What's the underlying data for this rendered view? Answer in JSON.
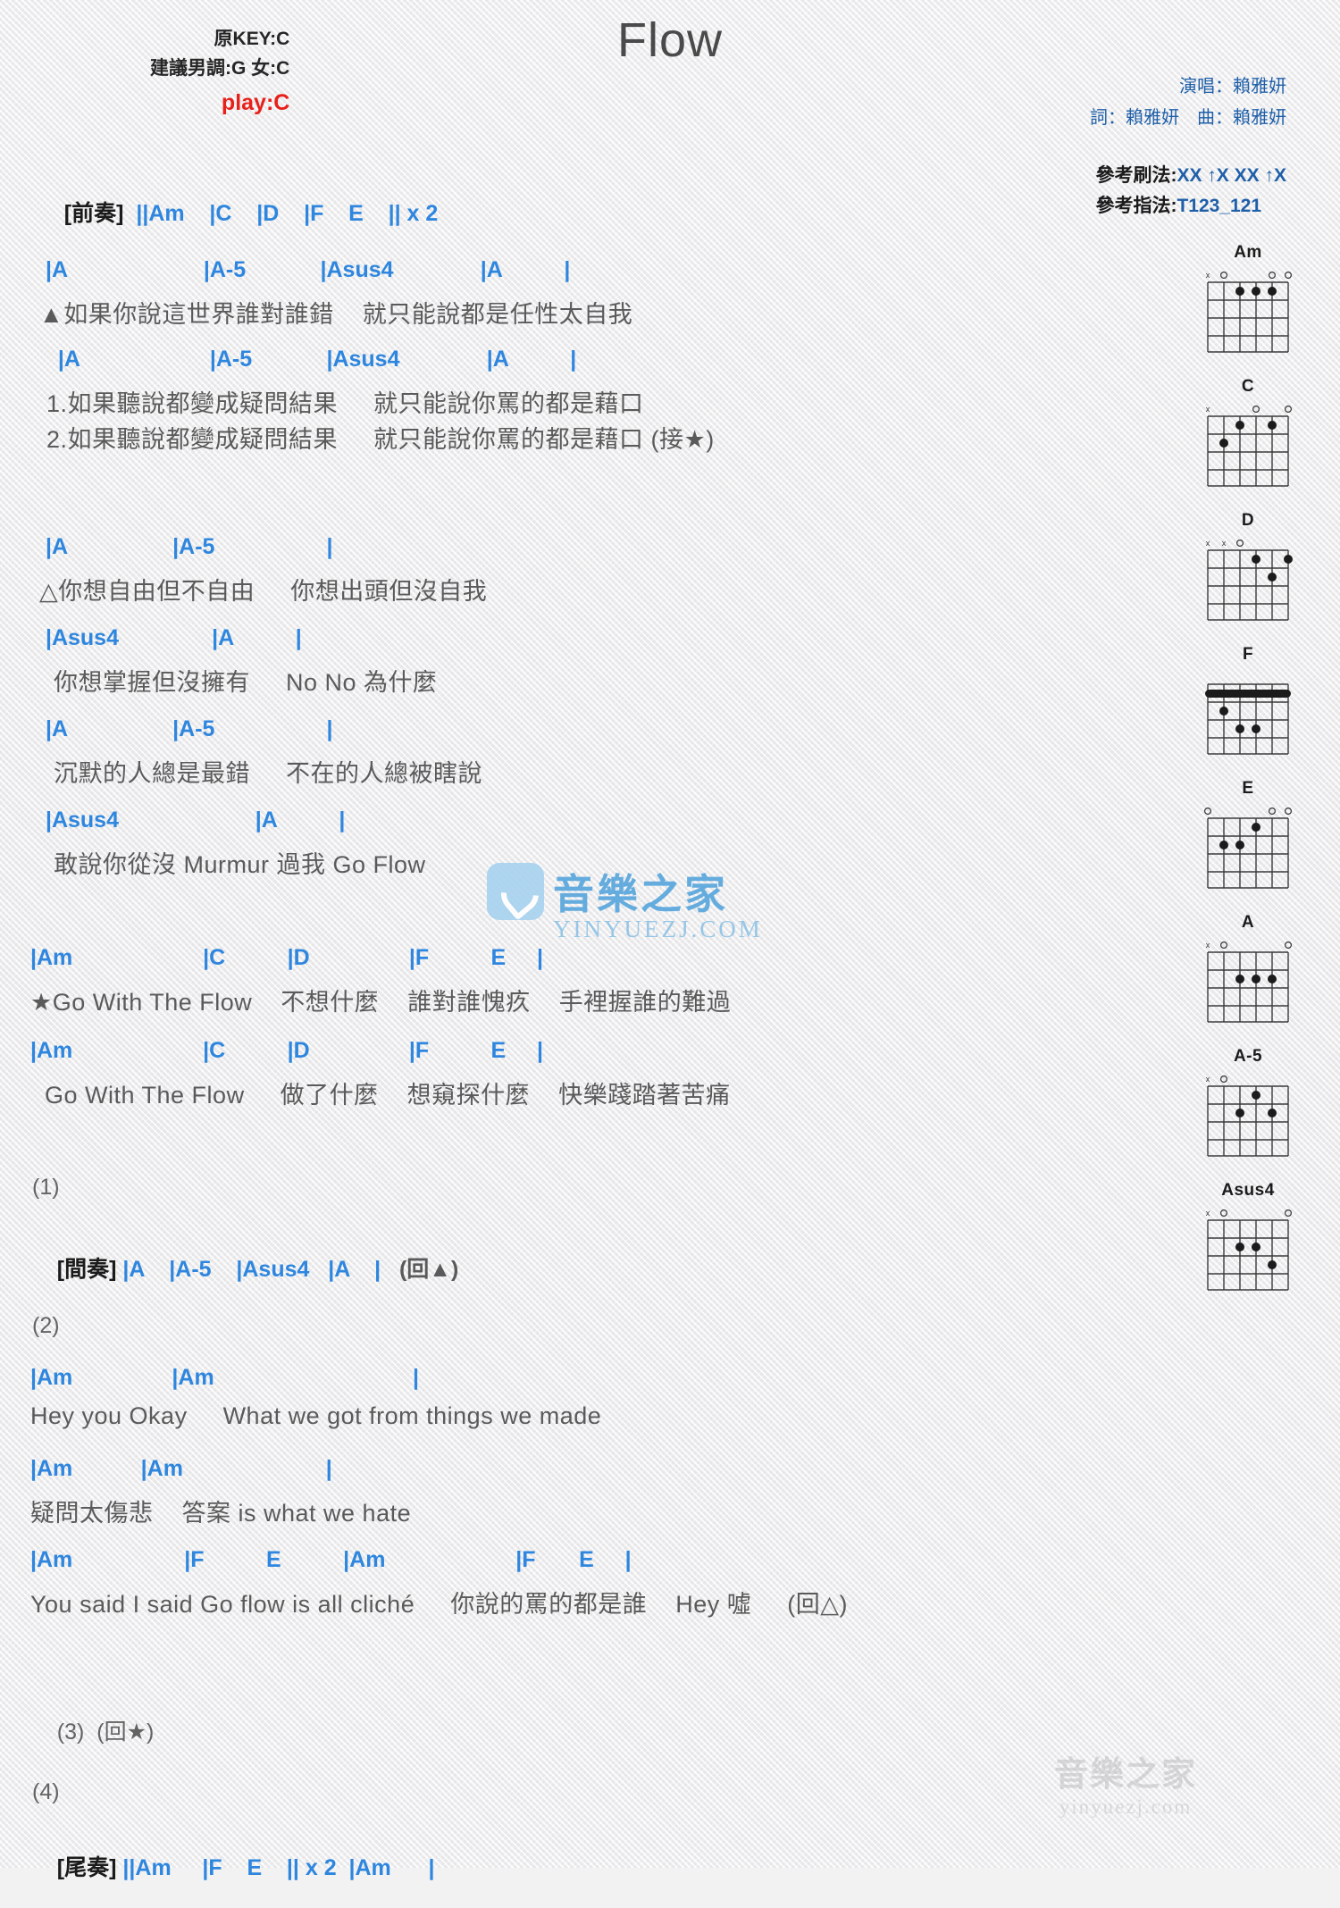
{
  "header": {
    "title": "Flow",
    "key_original": "原KEY:C",
    "key_suggest": "建議男調:G 女:C",
    "key_play": "play:C",
    "singer": "演唱：賴雅妍",
    "writer": "詞：賴雅妍　曲：賴雅妍",
    "strum_label": "參考刷法:",
    "strum_value": "XX ↑X XX ↑X",
    "finger_label": "參考指法:",
    "finger_value": "T123_121"
  },
  "colors": {
    "chord_blue": "#2e86de",
    "bar_orange": "#c8751d",
    "play_red": "#e8201a",
    "lyric_gray": "#5a5a5a",
    "credit_blue": "#1f5fa8"
  },
  "intro": {
    "tag": "[前奏]",
    "bars": "||Am    |C    |D    |F    E    || x 2"
  },
  "sections": [
    {
      "name": "verse-a",
      "lines": [
        {
          "type": "chord",
          "text": " |A                      |A-5            |Asus4              |A          |"
        },
        {
          "type": "lyric",
          "text": "▲如果你說這世界誰對誰錯    就只能說都是任性太自我"
        },
        {
          "type": "chord",
          "text": "   |A                     |A-5            |Asus4              |A          |"
        },
        {
          "type": "lyric",
          "text": " 1.如果聽說都變成疑問結果     就只能說你罵的都是藉口"
        },
        {
          "type": "lyric",
          "text": " 2.如果聽說都變成疑問結果     就只能說你罵的都是藉口 (接★)"
        }
      ]
    },
    {
      "name": "verse-b",
      "lines": [
        {
          "type": "chord",
          "text": " |A                 |A-5                  |"
        },
        {
          "type": "lyric",
          "text": "△你想自由但不自由     你想出頭但沒自我"
        },
        {
          "type": "chord",
          "text": " |Asus4               |A          |"
        },
        {
          "type": "lyric",
          "text": "  你想掌握但沒擁有     No No 為什麼"
        },
        {
          "type": "chord",
          "text": " |A                 |A-5                  |"
        },
        {
          "type": "lyric",
          "text": "  沉默的人總是最錯     不在的人總被瞎說"
        },
        {
          "type": "chord",
          "text": " |Asus4                      |A          |"
        },
        {
          "type": "lyric",
          "text": "  敢說你從沒 Murmur 過我 Go Flow"
        }
      ]
    },
    {
      "name": "chorus",
      "lines": [
        {
          "type": "chord",
          "text": "|Am                     |C          |D                |F          E     |"
        },
        {
          "type": "lyric",
          "text": "★Go With The Flow    不想什麼    誰對誰愧疚    手裡握誰的難過"
        },
        {
          "type": "chord",
          "text": "|Am                     |C          |D                |F          E     |"
        },
        {
          "type": "lyric",
          "text": "  Go With The Flow     做了什麼    想窺探什麼    快樂踐踏著苦痛"
        }
      ]
    }
  ],
  "part1": {
    "label": "(1)",
    "tag": "[間奏]",
    "bars": "|A    |A-5    |Asus4   |A    |",
    "repeat": "(回▲)"
  },
  "part2": {
    "label": "(2)",
    "lines": [
      {
        "type": "chord",
        "text": "|Am                |Am                                |"
      },
      {
        "type": "lyric",
        "text": "Hey you Okay     What we got from things we made"
      },
      {
        "type": "chord",
        "text": "|Am           |Am                       |"
      },
      {
        "type": "lyric",
        "text": "疑問太傷悲    答案 is what we hate"
      },
      {
        "type": "chord",
        "text": "|Am                  |F          E          |Am                     |F       E     |"
      },
      {
        "type": "lyric",
        "text": "You said I said Go flow is all cliché     你說的罵的都是誰    Hey 噓     (回△)"
      }
    ]
  },
  "part3": {
    "label": "(3)",
    "repeat": "(回★)"
  },
  "part4": {
    "label": "(4)",
    "tag": "[尾奏]",
    "bars": "||Am     |F    E    || x 2  |Am      |"
  },
  "watermark": {
    "icon": "water-drop-badge-icon",
    "zh": "音樂之家",
    "url": "YINYUEZJ.COM",
    "bottom_zh": "音樂之家",
    "bottom_url": "yinyuezj.com"
  },
  "chord_diagrams": [
    {
      "name": "Am",
      "markers": "o o o",
      "frets": [
        [
          -1,
          0
        ],
        [
          1,
          2
        ],
        [
          2,
          2
        ],
        [
          3,
          1
        ],
        [
          4,
          0
        ],
        [
          5,
          -1
        ]
      ],
      "dots": [
        [
          2,
          2
        ],
        [
          3,
          2
        ],
        [
          4,
          1
        ]
      ],
      "open": [
        1,
        5
      ],
      "muted": [
        0
      ]
    },
    {
      "name": "C",
      "markers": "o o",
      "dots": [
        [
          2,
          3
        ],
        [
          3,
          2
        ],
        [
          5,
          1
        ]
      ],
      "open": [
        3,
        5
      ],
      "muted": [
        0
      ]
    },
    {
      "name": "D",
      "markers": "o",
      "dots": [
        [
          3,
          2
        ],
        [
          4,
          3
        ],
        [
          5,
          2
        ]
      ],
      "open": [
        2
      ],
      "muted": [
        0,
        1
      ]
    },
    {
      "name": "F",
      "markers": "barre",
      "dots": [
        [
          1,
          1
        ],
        [
          2,
          2
        ],
        [
          3,
          3
        ],
        [
          4,
          3
        ]
      ],
      "barre": 1
    },
    {
      "name": "E",
      "markers": "o o o",
      "dots": [
        [
          1,
          2
        ],
        [
          2,
          2
        ],
        [
          3,
          1
        ]
      ],
      "open": [
        0,
        4,
        5
      ]
    },
    {
      "name": "A",
      "markers": "o o",
      "dots": [
        [
          2,
          2
        ],
        [
          3,
          2
        ],
        [
          4,
          2
        ]
      ],
      "open": [
        1,
        5
      ],
      "muted": [
        0
      ]
    },
    {
      "name": "A-5",
      "markers": "x o",
      "dots": [
        [
          2,
          2
        ],
        [
          3,
          1
        ],
        [
          4,
          2
        ]
      ],
      "open": [
        1
      ],
      "muted": [
        0
      ]
    },
    {
      "name": "Asus4",
      "markers": "o o",
      "dots": [
        [
          2,
          2
        ],
        [
          3,
          2
        ],
        [
          4,
          3
        ]
      ],
      "open": [
        1,
        5
      ],
      "muted": [
        0
      ]
    }
  ]
}
